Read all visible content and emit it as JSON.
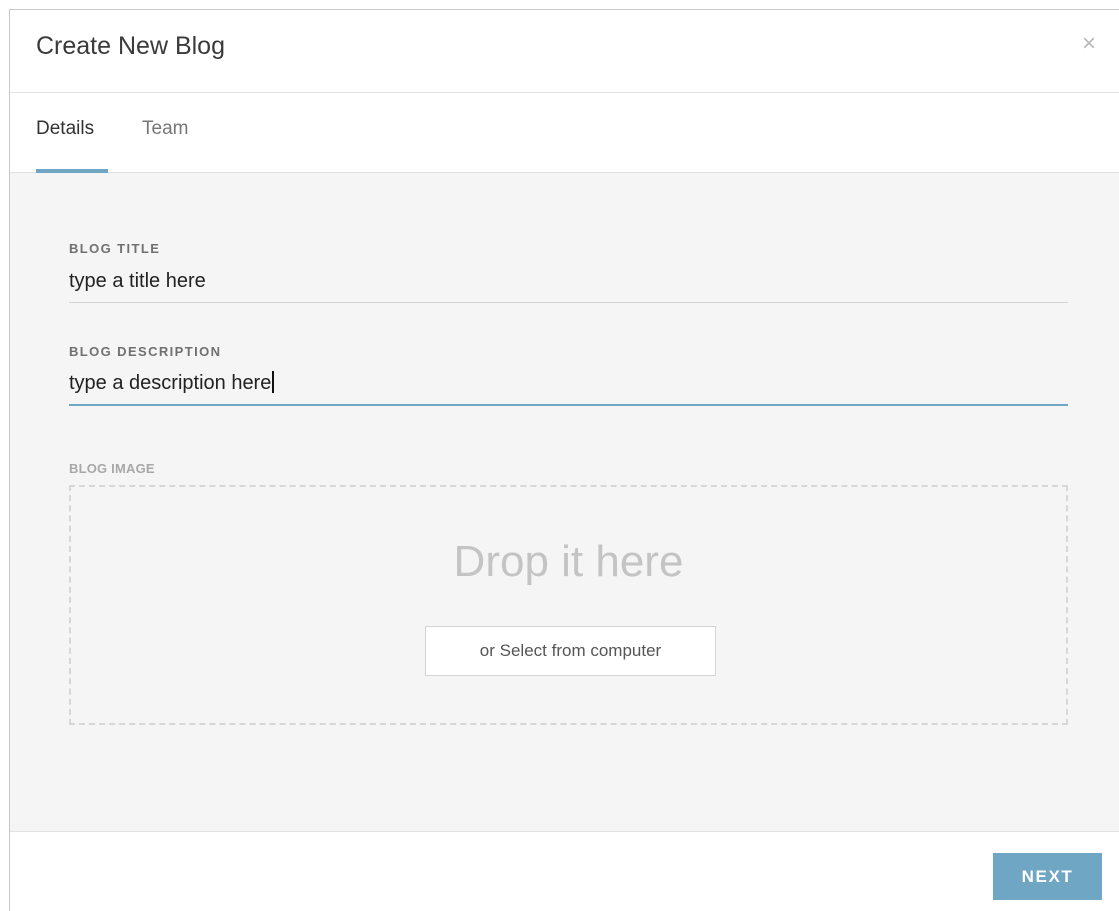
{
  "dialog": {
    "title": "Create New Blog",
    "close_icon": "close-icon",
    "close_glyph": "×"
  },
  "tabs": [
    {
      "label": "Details",
      "active": true
    },
    {
      "label": "Team",
      "active": false
    }
  ],
  "form": {
    "title_label": "BLOG TITLE",
    "title_value": "type a title here",
    "description_label": "BLOG DESCRIPTION",
    "description_value": "type a description here",
    "image_label": "BLOG IMAGE",
    "drop_text": "Drop it here",
    "select_button_label": "or Select from computer"
  },
  "footer": {
    "next_label": "NEXT"
  },
  "colors": {
    "accent": "#6ea6c4",
    "body_background": "#f5f5f5"
  }
}
